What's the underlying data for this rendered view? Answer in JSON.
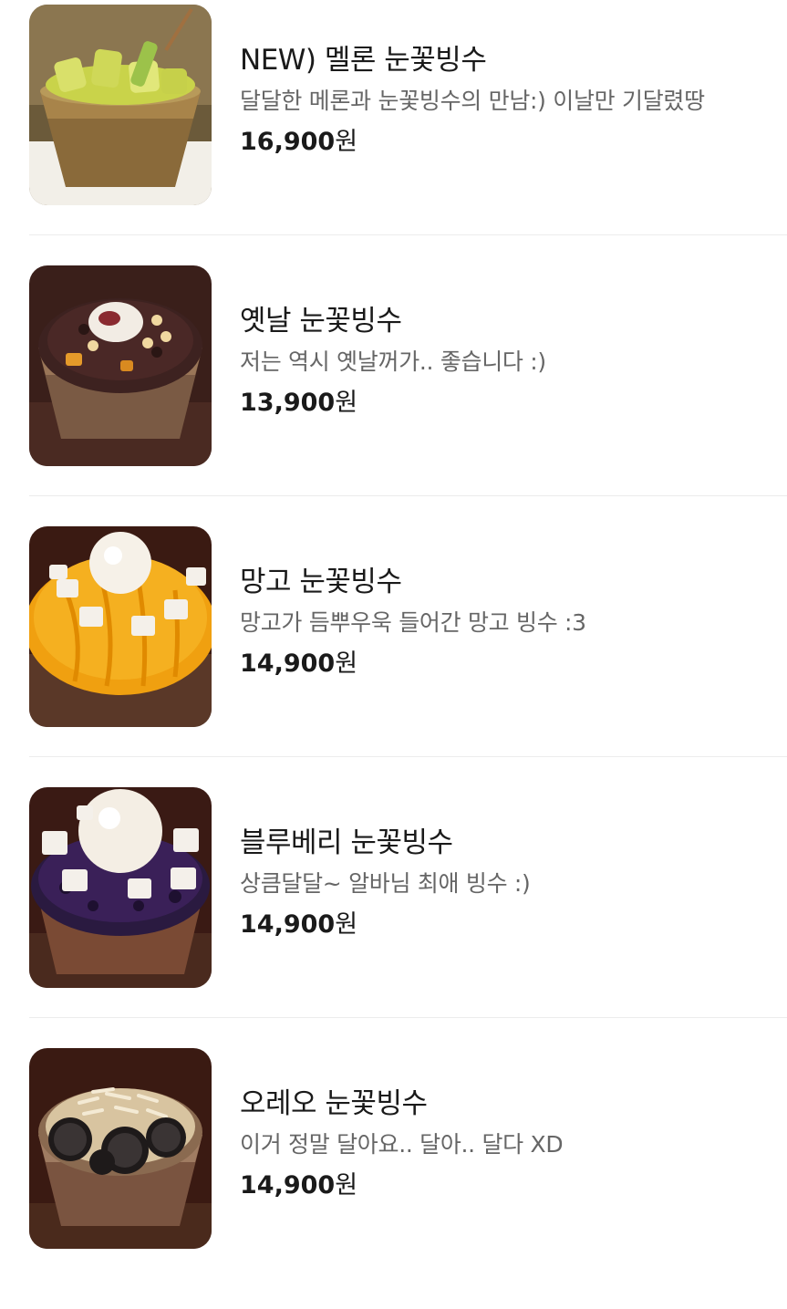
{
  "menu": {
    "currency": "원",
    "items": [
      {
        "name": "NEW) 멜론 눈꽃빙수",
        "description": "달달한 메론과 눈꽃빙수의 만남:) 이날만 기달렸땅",
        "price": "16,900",
        "photo": "melon-bingsu-photo"
      },
      {
        "name": "옛날 눈꽃빙수",
        "description": "저는 역시 옛날꺼가.. 좋습니다 :)",
        "price": "13,900",
        "photo": "redbean-bingsu-photo"
      },
      {
        "name": "망고 눈꽃빙수",
        "description": "망고가 듬뿌우욱 들어간 망고 빙수 :3",
        "price": "14,900",
        "photo": "mango-bingsu-photo"
      },
      {
        "name": "블루베리 눈꽃빙수",
        "description": "상큼달달~ 알바님 최애 빙수 :)",
        "price": "14,900",
        "photo": "blueberry-bingsu-photo"
      },
      {
        "name": "오레오 눈꽃빙수",
        "description": "이거 정말 달아요.. 달아.. 달다 XD",
        "price": "14,900",
        "photo": "oreo-bingsu-photo"
      }
    ]
  },
  "colors": {
    "text_primary": "#1a1a1a",
    "text_secondary": "#666666",
    "divider": "#ececec",
    "background": "#ffffff"
  }
}
